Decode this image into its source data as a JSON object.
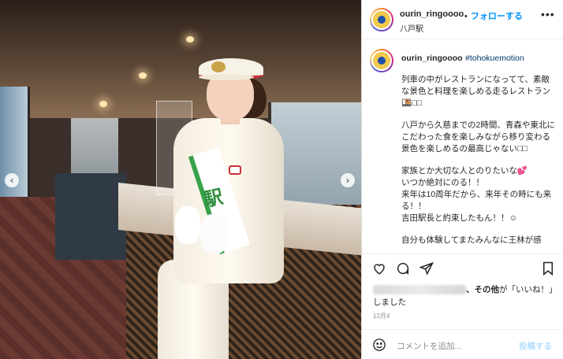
{
  "post": {
    "username": "ourin_ringoooo",
    "separator": "•",
    "follow_label": "フォローする",
    "location": "八戸駅",
    "more_label": "•••"
  },
  "caption": {
    "username": "ourin_ringoooo",
    "hashtag": "#tohokuemotion",
    "paragraphs": [
      "列車の中がレストランになってて、素敵な景色と料理を楽しめる走るレストラン🍱□□",
      "八戸から久慈までの2時間、青森や東北にこだわった食を楽しみながら移り変わる景色を楽しめるの最高じゃない□□",
      "家族とか大切な人とのりたいな💕\nいつか絶対にのる！！\n来年は10周年だから、来年その時にも来る！！\n吉田駅長と約束したもん！！☺",
      "自分も体験してまたみんなに王林が感"
    ]
  },
  "photo": {
    "sash_text": "駅",
    "prev_label": "‹",
    "next_label": "›"
  },
  "icons": {
    "like": "heart-icon",
    "comment": "comment-icon",
    "share": "share-icon",
    "save": "bookmark-icon",
    "emoji": "emoji-icon"
  },
  "likes": {
    "others_text": "、その他",
    "liked_text": "が「いいね！」しました"
  },
  "date": "12月4",
  "comment": {
    "placeholder": "コメントを追加...",
    "post_label": "投稿する"
  },
  "colors": {
    "link": "#0095f6",
    "hashtag": "#00376b",
    "post_disabled": "#b2dffc"
  }
}
